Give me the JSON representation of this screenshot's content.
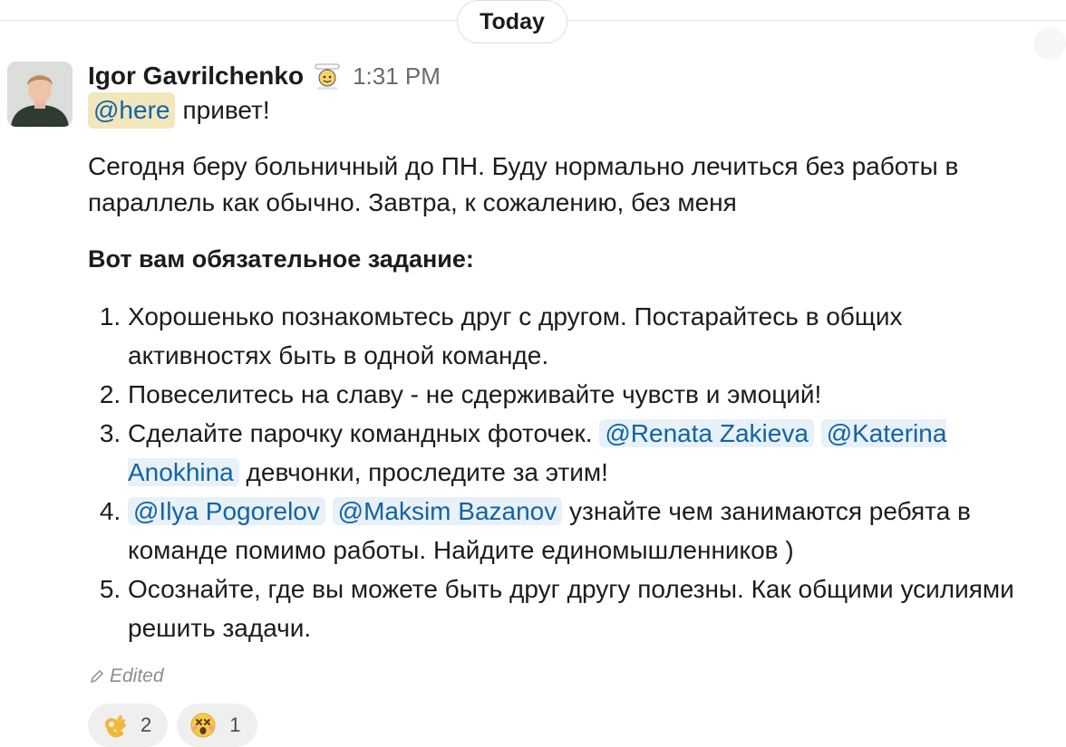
{
  "divider": {
    "label": "Today"
  },
  "message": {
    "author": "Igor Gavrilchenko",
    "status_icon": "badge-emoji-icon",
    "time": "1:31 PM",
    "mention_here": "@here",
    "greeting": "привет!",
    "paragraph": "Сегодня беру больничный до ПН. Буду нормально лечиться без работы в параллель как обычно. Завтра, к сожалению, без меня",
    "bold_heading": "Вот вам обязательное задание:",
    "tasks": [
      {
        "text": "Хорошенько познакомьтесь друг с другом. Постарайтесь в общих активностях быть в одной команде."
      },
      {
        "text": "Повеселитесь на славу - не сдерживайте чувств и эмоций!"
      },
      {
        "text_before": "Сделайте парочку командных фоточек. ",
        "mention_1": "@Renata Zakieva",
        "mention_2": "@Katerina Anokhina",
        "text_after": " девчонки, проследите за этим!"
      },
      {
        "mention_1": "@Ilya Pogorelov",
        "mention_2": "@Maksim Bazanov",
        "text_after": " узнайте чем занимаются ребята в команде помимо работы. Найдите единомышленников )"
      },
      {
        "text": "Осознайте, где вы можете быть друг другу полезны. Как общими усилиями решить задачи."
      }
    ],
    "edited_label": "Edited",
    "reactions": [
      {
        "emoji": "ok-hand",
        "count": "2"
      },
      {
        "emoji": "dizzy-face",
        "count": "1"
      }
    ]
  },
  "colors": {
    "mention_text": "#1264a3",
    "mention_bg": "#e8f0f8",
    "here_bg": "#f2e6bd"
  }
}
